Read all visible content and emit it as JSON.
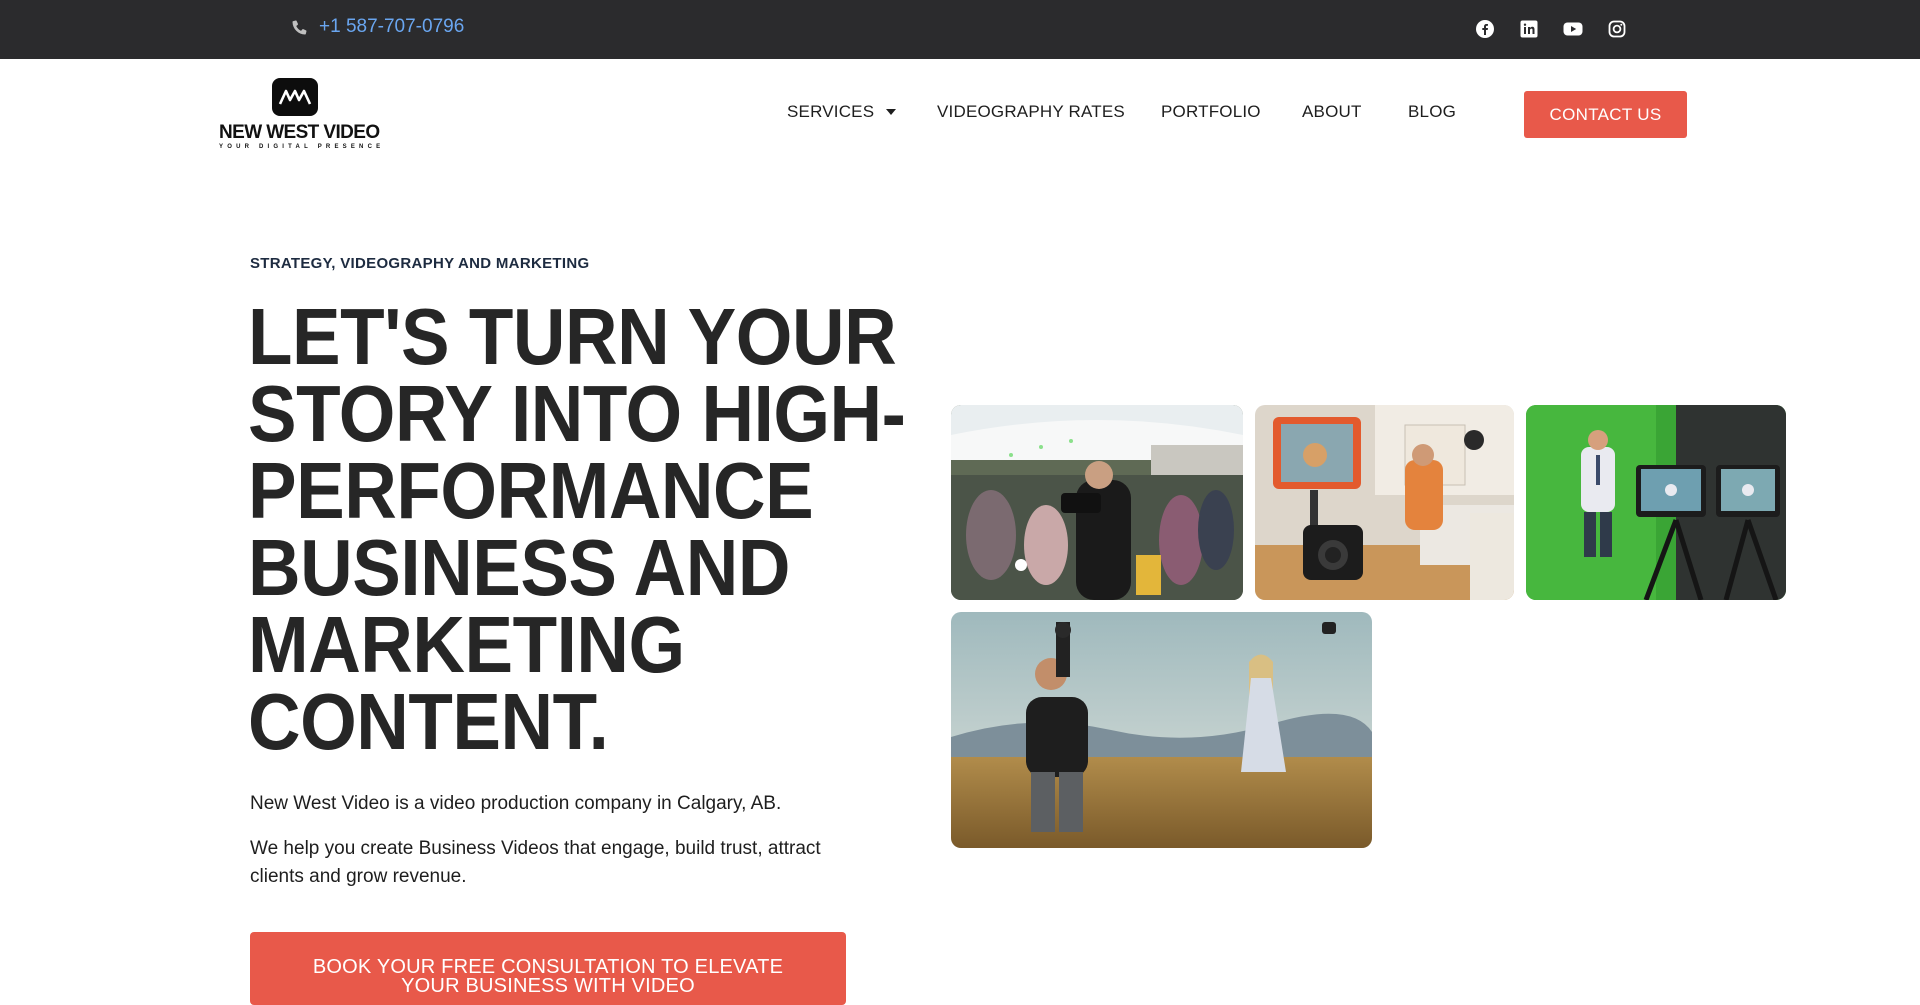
{
  "topbar": {
    "phone": "+1 587-707-0796",
    "phone_icon": "phone-icon",
    "socials": [
      "facebook-icon",
      "linkedin-icon",
      "youtube-icon",
      "instagram-icon"
    ]
  },
  "brand": {
    "name": "NEW WEST VIDEO",
    "tagline": "YOUR DIGITAL PRESENCE"
  },
  "nav": {
    "services": "SERVICES",
    "rates": "VIDEOGRAPHY RATES",
    "portfolio": "PORTFOLIO",
    "about": "ABOUT",
    "blog": "BLOG",
    "contact": "CONTACT US"
  },
  "hero": {
    "eyebrow": "STRATEGY, VIDEOGRAPHY AND MARKETING",
    "headline": [
      "LET'S TURN YOUR",
      "STORY INTO HIGH-",
      "PERFORMANCE",
      "BUSINESS AND",
      "MARKETING",
      "CONTENT."
    ],
    "para1": "New West Video is a video production company in Calgary, AB.",
    "para2": "We help you create Business Videos that engage, build trust, attract clients and grow revenue.",
    "cta": "BOOK YOUR FREE CONSULTATION TO ELEVATE YOUR BUSINESS WITH VIDEO"
  },
  "colors": {
    "topbar": "#2b2b2d",
    "link": "#6aa6f0",
    "accent": "#e8594a",
    "heading": "#262626"
  }
}
